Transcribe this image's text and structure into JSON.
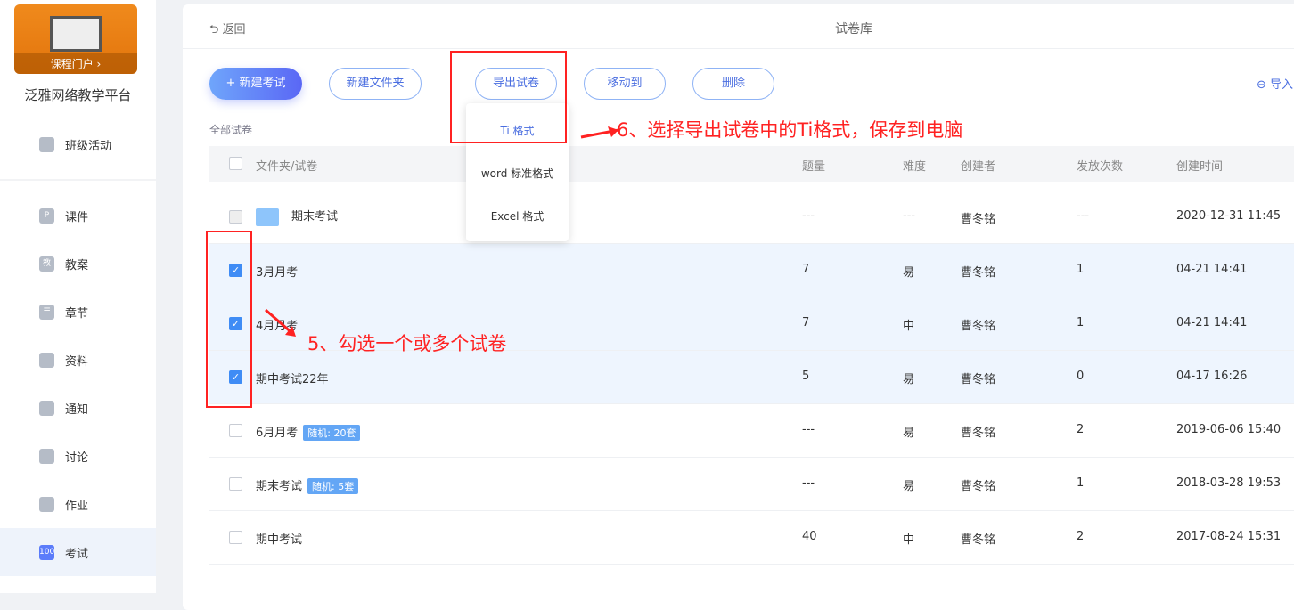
{
  "sidebar": {
    "banner_caption": "课程门户 ›",
    "platform": "泛雅网络教学平台",
    "top_item": "班级活动",
    "items": [
      {
        "label": "课件",
        "icon": "P"
      },
      {
        "label": "教案",
        "icon": "教"
      },
      {
        "label": "章节",
        "icon": "☰"
      },
      {
        "label": "资料",
        "icon": ""
      },
      {
        "label": "通知",
        "icon": ""
      },
      {
        "label": "讨论",
        "icon": ""
      },
      {
        "label": "作业",
        "icon": ""
      },
      {
        "label": "考试",
        "icon": "100"
      }
    ]
  },
  "header": {
    "back": "⮌ 返回",
    "title": "试卷库"
  },
  "toolbar": {
    "new_exam": "+ 新建考试",
    "new_folder": "新建文件夹",
    "export": "导出试卷",
    "move": "移动到",
    "delete": "删除",
    "import": "⊖ 导入"
  },
  "breadcrumb": "全部试卷",
  "dropdown": [
    "Ti 格式",
    "word 标准格式",
    "Excel 格式"
  ],
  "columns": [
    "文件夹/试卷",
    "题量",
    "难度",
    "创建者",
    "发放次数",
    "创建时间"
  ],
  "rows": [
    {
      "name": "期末考试",
      "badge": null,
      "count": "---",
      "diff": "---",
      "creator": "曹冬铭",
      "times": "---",
      "created": "2020-12-31 11:45"
    },
    {
      "name": "3月月考",
      "badge": null,
      "count": "7",
      "diff": "易",
      "creator": "曹冬铭",
      "times": "1",
      "created": "04-21 14:41"
    },
    {
      "name": "4月月考",
      "badge": null,
      "count": "7",
      "diff": "中",
      "creator": "曹冬铭",
      "times": "1",
      "created": "04-21 14:41"
    },
    {
      "name": "期中考试22年",
      "badge": null,
      "count": "5",
      "diff": "易",
      "creator": "曹冬铭",
      "times": "0",
      "created": "04-17 16:26"
    },
    {
      "name": "6月月考",
      "badge": "随机: 20套",
      "count": "---",
      "diff": "易",
      "creator": "曹冬铭",
      "times": "2",
      "created": "2019-06-06 15:40"
    },
    {
      "name": "期末考试",
      "badge": "随机: 5套",
      "count": "---",
      "diff": "易",
      "creator": "曹冬铭",
      "times": "1",
      "created": "2018-03-28 19:53"
    },
    {
      "name": "期中考试",
      "badge": null,
      "count": "40",
      "diff": "中",
      "creator": "曹冬铭",
      "times": "2",
      "created": "2017-08-24 15:31"
    }
  ],
  "annotations": {
    "step6": "6、选择导出试卷中的Ti格式，保存到电脑",
    "step5": "5、勾选一个或多个试卷"
  }
}
